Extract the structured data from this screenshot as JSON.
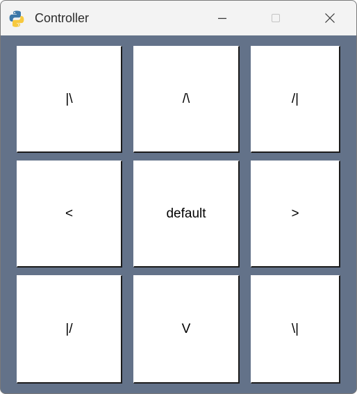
{
  "window": {
    "title": "Controller",
    "icon": "python-icon",
    "controls": [
      "minimize-icon",
      "maximize-icon",
      "close-icon"
    ]
  },
  "colors": {
    "background": "#637289",
    "titlebar": "#f3f3f3",
    "button": "#ffffff"
  },
  "buttons": {
    "up_left": "|\\",
    "up": "/\\",
    "up_right": "/|",
    "left": "<",
    "center": "default",
    "right": ">",
    "down_left": "|/",
    "down": "V",
    "down_right": "\\|"
  }
}
